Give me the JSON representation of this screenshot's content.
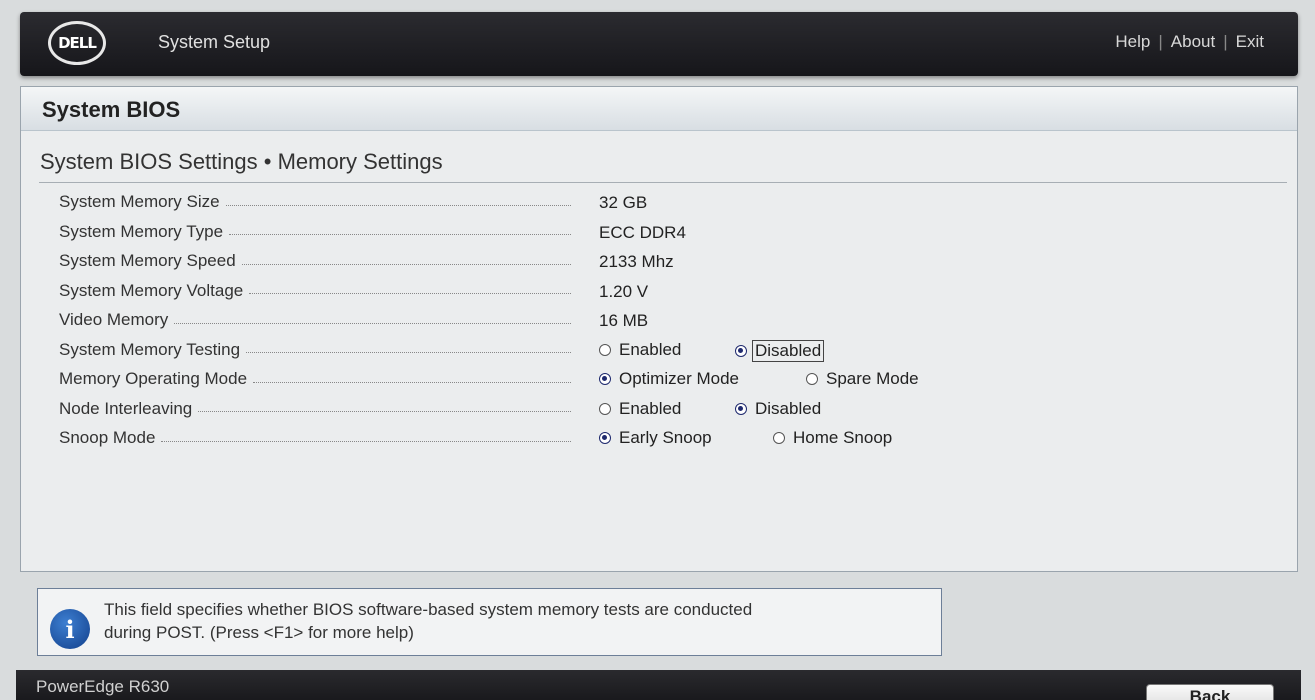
{
  "header": {
    "logo_text": "DELL",
    "title": "System Setup",
    "links": [
      "Help",
      "About",
      "Exit"
    ]
  },
  "panel": {
    "title": "System BIOS",
    "breadcrumb": "System BIOS Settings • Memory Settings"
  },
  "rows": [
    {
      "label": "System Memory Size",
      "value": "32 GB"
    },
    {
      "label": "System Memory Type",
      "value": "ECC DDR4"
    },
    {
      "label": "System Memory Speed",
      "value": "2133 Mhz"
    },
    {
      "label": "System Memory Voltage",
      "value": "1.20 V"
    },
    {
      "label": "Video Memory",
      "value": "16 MB"
    },
    {
      "label": "System Memory Testing",
      "options": [
        "Enabled",
        "Disabled"
      ],
      "selected": "Disabled"
    },
    {
      "label": "Memory Operating Mode",
      "options": [
        "Optimizer Mode",
        "Spare Mode"
      ],
      "selected": "Optimizer Mode"
    },
    {
      "label": "Node Interleaving",
      "options": [
        "Enabled",
        "Disabled"
      ],
      "selected": "Disabled"
    },
    {
      "label": "Snoop Mode",
      "options": [
        "Early Snoop",
        "Home Snoop"
      ],
      "selected": "Early Snoop"
    }
  ],
  "help": {
    "icon": "info-icon",
    "text_line1": "This field specifies whether BIOS software-based system memory tests are conducted",
    "text_line2": "during POST. (Press <F1> for more help)"
  },
  "footer": {
    "model": "PowerEdge R630",
    "back_label": "Back"
  },
  "colors": {
    "header_bg": "#1c1c20",
    "panel_bg": "#ebedee",
    "radio_selected": "#1f2a6e",
    "info_icon": "#1f5fb8"
  }
}
